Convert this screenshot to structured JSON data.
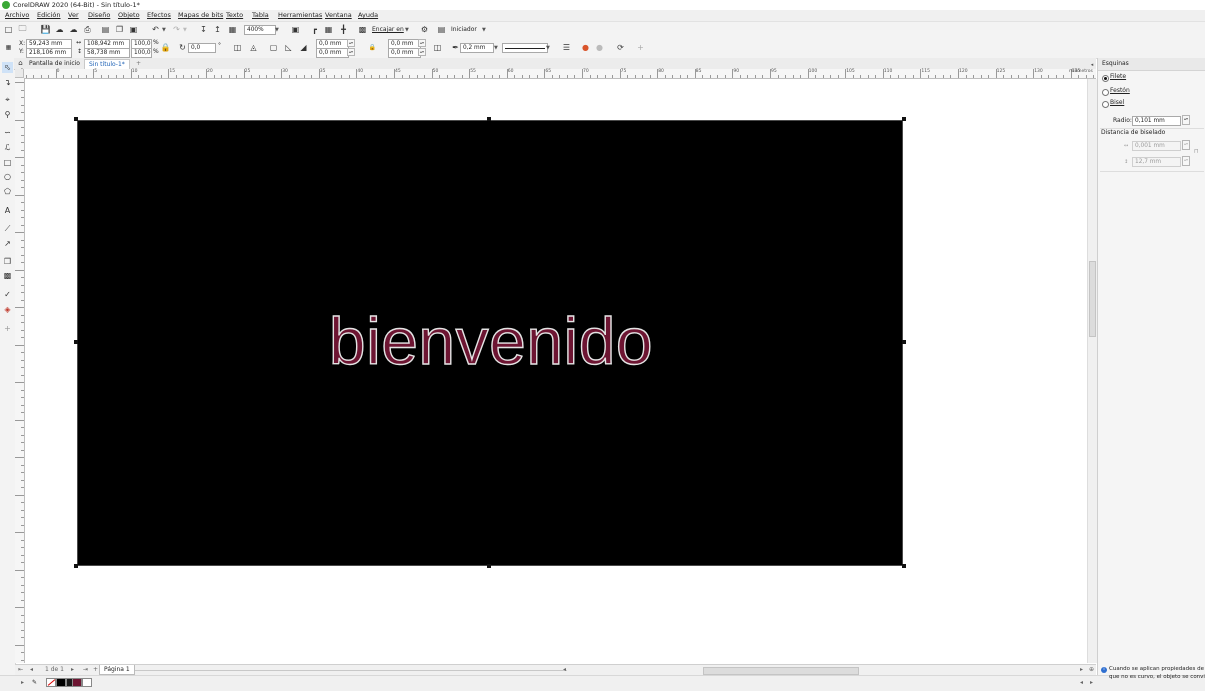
{
  "titlebar": {
    "title": "CorelDRAW 2020 (64-Bit) - Sin título-1*"
  },
  "menu": [
    "Archivo",
    "Edición",
    "Ver",
    "Diseño",
    "Objeto",
    "Efectos",
    "Mapas de bits",
    "Texto",
    "Tabla",
    "Herramientas",
    "Ventana",
    "Ayuda"
  ],
  "toolbar1": {
    "zoom": "400%",
    "snap_label": "Encajar en",
    "workspace_label": "Iniciador"
  },
  "property_bar": {
    "x_label": "X:",
    "x_value": "59,243 mm",
    "y_label": "Y:",
    "y_value": "218,106 mm",
    "w_value": "108,942 mm",
    "h_value": "58,738 mm",
    "scale_w": "100,0",
    "scale_h": "100,0",
    "pct": "%",
    "rotation": "0,0",
    "degree": "°",
    "corner_tl": "0,0 mm",
    "corner_bl": "0,0 mm",
    "corner_tr": "0,0 mm",
    "corner_br": "0,0 mm",
    "outline_width": "0,2 mm"
  },
  "tabs": [
    {
      "label": "Pantalla de inicio",
      "active": false
    },
    {
      "label": "Sin título-1*",
      "active": true
    }
  ],
  "ruler": {
    "h_ticks": [
      "-5",
      "0",
      "5",
      "10",
      "15",
      "20",
      "25",
      "30",
      "35",
      "40",
      "45",
      "50",
      "55",
      "60",
      "65",
      "70",
      "75",
      "80",
      "85",
      "90",
      "95",
      "100",
      "105",
      "110",
      "115",
      "120",
      "125",
      "130",
      "135"
    ],
    "unit": "milímetros"
  },
  "canvas": {
    "text": "bienvenido",
    "text_fill": "#6d1532",
    "text_outline": "#e4e4e4",
    "rect_fill": "#000000"
  },
  "pagebar": {
    "page_label": "Página 1"
  },
  "docker": {
    "title": "Esquinas",
    "options": [
      {
        "label": "Filete",
        "selected": true
      },
      {
        "label": "Festón",
        "selected": false
      },
      {
        "label": "Bisel",
        "selected": false
      }
    ],
    "radius_label": "Radio:",
    "radius_value": "0,101 mm",
    "bevel_label": "Distancia de biselado",
    "bevel_1": "0,001 mm",
    "bevel_2": "12,7 mm",
    "info": "Cuando se aplican propiedades de e",
    "info2": "que no es curvo, el objeto se convier"
  },
  "palette": [
    "#ffffff",
    "#000000",
    "#1a1a1a",
    "#2b2b2b",
    "#6d1532",
    "#ffffff"
  ]
}
